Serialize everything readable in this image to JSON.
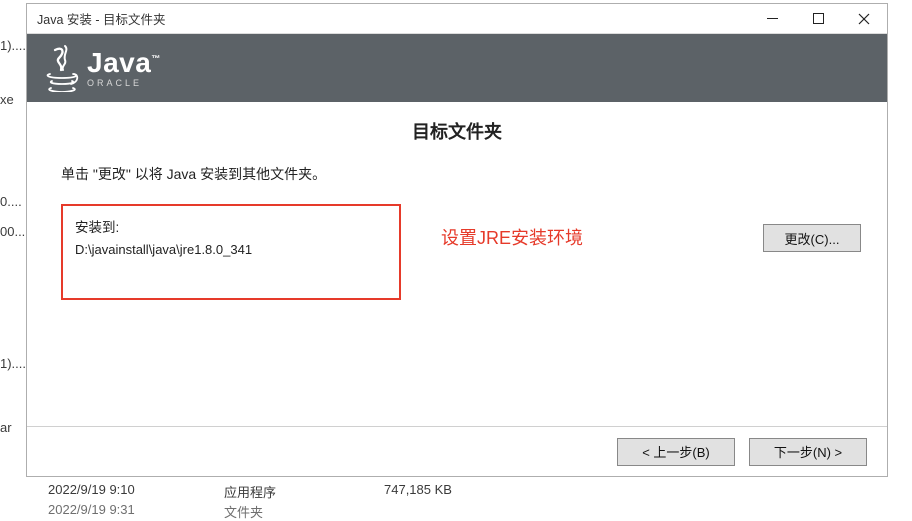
{
  "window": {
    "title": "Java 安装 - 目标文件夹"
  },
  "header": {
    "logo_word": "Java",
    "logo_tm": "™",
    "oracle": "ORACLE"
  },
  "content": {
    "section_title": "目标文件夹",
    "instruction": "单击 \"更改\" 以将 Java 安装到其他文件夹。",
    "install_to_label": "安装到:",
    "install_path": "D:\\javainstall\\java\\jre1.8.0_341",
    "annotation": "设置JRE安装环境",
    "change_button": "更改(C)..."
  },
  "footer": {
    "back": "< 上一步(B)",
    "next": "下一步(N) >"
  },
  "background": {
    "left_frag_1": "1)....",
    "left_frag_2": "xe",
    "left_frag_3": "0....",
    "left_frag_4": "00...",
    "left_frag_5": "1)....",
    "left_frag_6": "ar",
    "row1_date": "2022/9/19 9:10",
    "row1_type": "应用程序",
    "row1_size": "747,185 KB",
    "row2_date": "2022/9/19 9:31",
    "row2_type": "文件夹"
  }
}
